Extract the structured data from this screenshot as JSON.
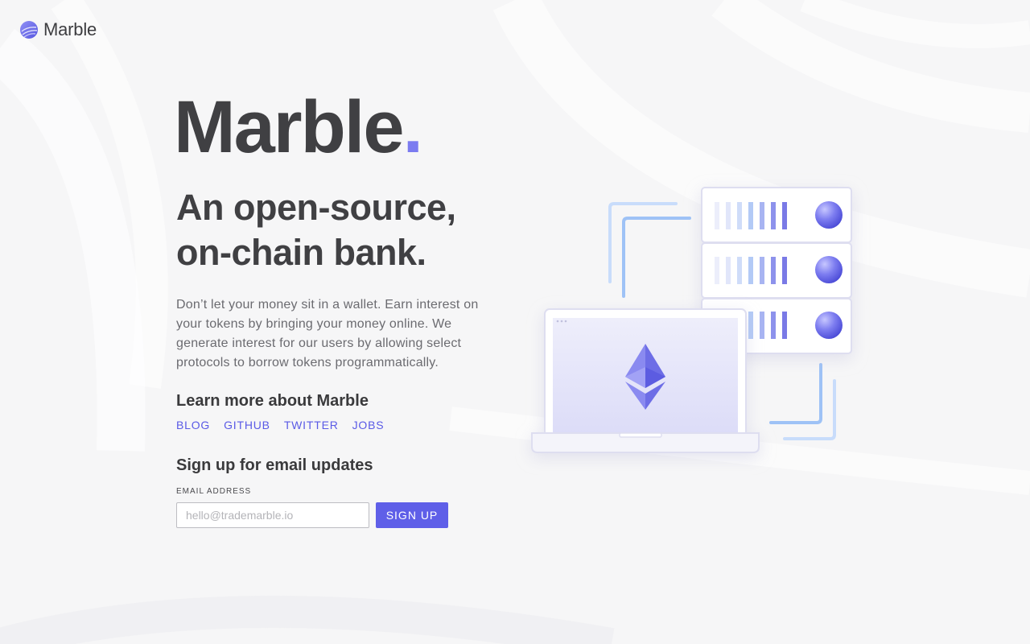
{
  "brand": {
    "name": "Marble",
    "accent": "#6060e8"
  },
  "hero": {
    "title": "Marble",
    "dot": ".",
    "tagline_line1": "An open-source,",
    "tagline_line2": "on-chain bank."
  },
  "description": "Don’t let your money sit in a wallet. Earn interest on your tokens by bringing your money online. We generate interest for our users by allowing select protocols to borrow tokens programmatically.",
  "learn_more": {
    "heading": "Learn more about Marble",
    "links": [
      {
        "label": "BLOG"
      },
      {
        "label": "GITHUB"
      },
      {
        "label": "TWITTER"
      },
      {
        "label": "JOBS"
      }
    ]
  },
  "signup": {
    "heading": "Sign up for email updates",
    "email_label": "EMAIL ADDRESS",
    "email_placeholder": "hello@trademarble.io",
    "email_value": "",
    "button_label": "SIGN UP"
  },
  "illustration": {
    "server_count": 3,
    "icons": [
      "laptop-icon",
      "ethereum-icon",
      "server-rack-icon",
      "marble-orb-icon"
    ]
  }
}
